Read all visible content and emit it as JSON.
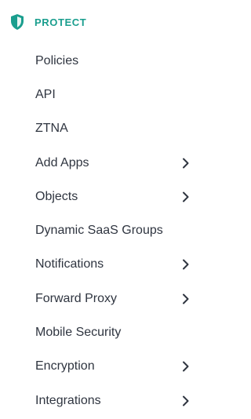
{
  "section": {
    "title": "PROTECT",
    "icon": "shield-icon",
    "accent_color": "#1a9e8e"
  },
  "items": [
    {
      "label": "Policies",
      "has_submenu": false
    },
    {
      "label": "API",
      "has_submenu": false
    },
    {
      "label": "ZTNA",
      "has_submenu": false
    },
    {
      "label": "Add Apps",
      "has_submenu": true,
      "icon": "chevron-right-icon"
    },
    {
      "label": "Objects",
      "has_submenu": true,
      "icon": "chevron-right-icon"
    },
    {
      "label": "Dynamic SaaS Groups",
      "has_submenu": false
    },
    {
      "label": "Notifications",
      "has_submenu": true,
      "icon": "chevron-right-icon"
    },
    {
      "label": "Forward Proxy",
      "has_submenu": true,
      "icon": "chevron-right-icon"
    },
    {
      "label": "Mobile Security",
      "has_submenu": false
    },
    {
      "label": "Encryption",
      "has_submenu": true,
      "icon": "chevron-right-icon"
    },
    {
      "label": "Integrations",
      "has_submenu": true,
      "icon": "chevron-right-icon"
    }
  ]
}
